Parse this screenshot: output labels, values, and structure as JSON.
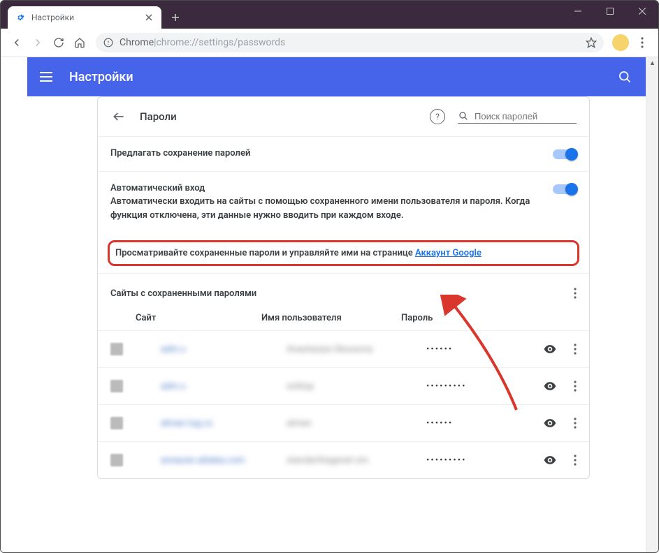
{
  "window": {
    "tab_title": "Настройки"
  },
  "omnibox": {
    "prefix": "Chrome",
    "divider": " | ",
    "path": "chrome://settings/passwords"
  },
  "blue_header": {
    "title": "Настройки"
  },
  "subpage": {
    "title": "Пароли",
    "search_placeholder": "Поиск паролей"
  },
  "options": {
    "offer_save": "Предлагать сохранение паролей",
    "auto_login_title": "Автоматический вход",
    "auto_login_desc": "Автоматически входить на сайты с помощью сохраненного имени пользователя и пароля. Когда функция отключена, эти данные нужно вводить при каждом входе."
  },
  "highlight": {
    "text": "Просматривайте сохраненные пароли и управляйте ими на странице ",
    "link": "Аккаунт Google"
  },
  "saved": {
    "title": "Сайты с сохраненными паролями",
    "columns": {
      "site": "Сайт",
      "user": "Имя пользователя",
      "pass": "Пароль"
    },
    "rows": [
      {
        "site": "adm.c",
        "user": "Anastasiya Uksusova",
        "pass": "••••••"
      },
      {
        "site": "adm.c",
        "user": "solitup",
        "pass": "•••••••••"
      },
      {
        "site": "alman tug.cc",
        "user": "alman",
        "pass": "••••••"
      },
      {
        "site": "annacen.altalea.com",
        "user": "standerthegenet om",
        "pass": "•••••••••"
      }
    ]
  }
}
